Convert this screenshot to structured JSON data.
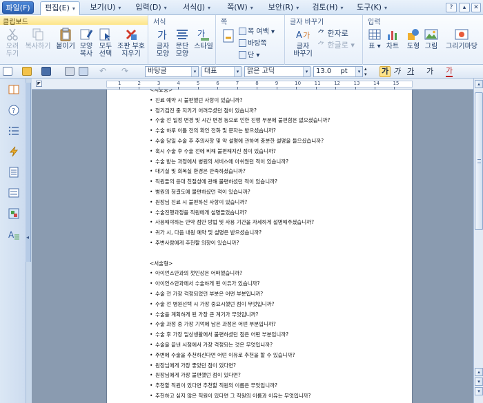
{
  "menubar": {
    "items": [
      {
        "label": "파일(F)"
      },
      {
        "label": "편집(E)"
      },
      {
        "label": "보기(U)"
      },
      {
        "label": "입력(D)"
      },
      {
        "label": "서식(J)"
      },
      {
        "label": "쪽(W)"
      },
      {
        "label": "보안(R)"
      },
      {
        "label": "검토(H)"
      },
      {
        "label": "도구(K)"
      }
    ],
    "help": "?"
  },
  "ribbon": {
    "clipboard": {
      "label": "클립보드",
      "cut": "오려\n두기",
      "copy": "복사하기",
      "paste": "붙이기",
      "copy_format": "모양\n복사",
      "select_all": "모두\n선택",
      "find_replace": "조판 부호\n지우기"
    },
    "format": {
      "label": "서식",
      "char_shape": "글자\n모양",
      "para_shape": "문단\n모양",
      "style": "스타일"
    },
    "page": {
      "label": "쪽",
      "margin": "쪽 여백",
      "background": "바탕쪽",
      "columns": "단"
    },
    "convert": {
      "label": "글자 바꾸기",
      "char_change": "글자\n바꾸기",
      "to_hanja": "한자로",
      "to_hangul": "한글로"
    },
    "insert": {
      "label": "입력",
      "table": "표",
      "chart": "차트",
      "shape": "도형",
      "picture": "그림",
      "drawing": "그리기마당"
    }
  },
  "toolbar": {
    "style_combo": "바탕글",
    "lang_combo": "대표",
    "font_combo": "맑은 고딕",
    "size_combo": "13.0",
    "size_unit": "pt",
    "bold": "가",
    "italic": "가",
    "underline": "가",
    "strike": "가",
    "color": "가"
  },
  "document": {
    "lines": [
      "<치료중>",
      "진료 예약 시 불편했던 사항이 있습니까?",
      "정기검진 중 지키기 어려우셨던 점이 있습니까?",
      "수술 전 일정 변경 및 시간 변경 등으로 인한 진행 부분에 불편함은 없으셨습니까?",
      "수술 하루 이틀 전의 확인 전화 및 문자는 받으셨습니까?",
      "수술 당일 수술 후 주의사항 및 약 설명에 관하여 충분한 설명을 들으셨습니까?",
      "혹시 수술 후 수술 전에 비해 불편해지신 점이 있습니까?",
      "수술 받는 과정에서 병원의 서비스에 아쉬웠던 적이 있습니까?",
      "대기실 및 회복실 환경은 만족하셨습니까?",
      "직원들의 응대 친절성에 관해 불편하셨던 적이 있습니까?",
      "병원의 청결도에 불편하셨던 적이 있습니까?",
      "원장님 진료 시 불편하신 사항이 있습니까?",
      "수술진행과정을 직원에게 설명들었습니까?",
      "사용해야하는 안약 점안 방법 및 사용 기간을 자세하게 설명해주셨습니까?",
      "귀가 시, 다음 내원 예약 및 설명은 받으셨습니까?",
      "주변사람에게 추천할 의향이 있습니까?",
      "",
      "<서술형>",
      "아이언스안과의 첫인상은 어떠했습니까?",
      "아이언스안과에서 수술하게 된 이유가 있습니까?",
      "수술 전 가장 걱정되었던 부분은 어떤 부분입니까?",
      "수술 전 병원선택 시 가장 중요시했던 점이 무엇입니까?",
      "수술을 계획하게 된 가장 큰 계기가 무엇입니까?",
      "수술 과정 중 가장 기억에 남은 과정은 어떤 부분입니까?",
      "수술 후 가장 일상생활에서 불편하셨던 점은 어떤 부분입니까?",
      "수술을 끝낸 시점에서 가장 걱정되는 것은 무엇입니까?",
      "주변에 수술을 추천하신다면 어떤 이유로 추천을 할 수 있습니까?",
      "원장님에게 가장 좋았던 점이 있다면?",
      "원장님에게 가장 불편했던 점이 있다면?",
      "추천할 직원이 있다면 추천할 직원의 이름은 무엇입니까?",
      "추천하고 싶지 않은 직원이 있다면 그 직원의 이름과 이유는 무엇입니까?"
    ],
    "bullet": "•"
  },
  "ruler": {
    "numbers": [
      "1",
      "2",
      "3",
      "4",
      "5",
      "6",
      "7",
      "8",
      "9",
      "10",
      "11",
      "12",
      "13",
      "14",
      "15"
    ]
  },
  "colors": {
    "accent": "#2a5fb0",
    "ribbon_bg": "#e8f0fa",
    "workspace": "#8a9bb0"
  }
}
